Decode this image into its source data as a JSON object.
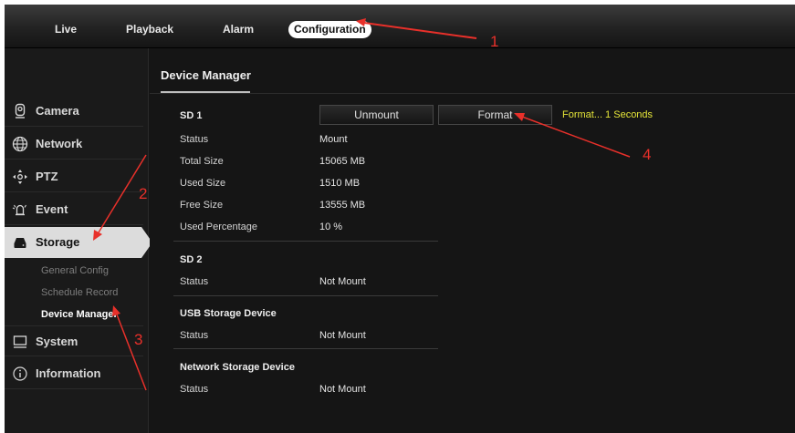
{
  "topnav": {
    "tabs": [
      {
        "label": "Live"
      },
      {
        "label": "Playback"
      },
      {
        "label": "Alarm"
      },
      {
        "label": "Configuration"
      }
    ]
  },
  "sidebar": {
    "items": [
      {
        "label": "Camera",
        "icon": "camera-icon"
      },
      {
        "label": "Network",
        "icon": "globe-icon"
      },
      {
        "label": "PTZ",
        "icon": "ptz-icon"
      },
      {
        "label": "Event",
        "icon": "event-icon"
      },
      {
        "label": "Storage",
        "icon": "storage-icon"
      },
      {
        "label": "System",
        "icon": "monitor-icon"
      },
      {
        "label": "Information",
        "icon": "info-icon"
      }
    ],
    "storage_subitems": [
      {
        "label": "General Config"
      },
      {
        "label": "Schedule Record"
      },
      {
        "label": "Device Manager"
      }
    ]
  },
  "main": {
    "title": "Device Manager",
    "sd1": {
      "title": "SD 1",
      "unmount_label": "Unmount",
      "format_label": "Format",
      "format_status": "Format... 1 Seconds",
      "rows": [
        {
          "label": "Status",
          "value": "Mount"
        },
        {
          "label": "Total Size",
          "value": "15065 MB"
        },
        {
          "label": "Used Size",
          "value": "1510 MB"
        },
        {
          "label": "Free Size",
          "value": "13555 MB"
        },
        {
          "label": "Used Percentage",
          "value": "10 %"
        }
      ]
    },
    "sd2": {
      "title": "SD 2",
      "rows": [
        {
          "label": "Status",
          "value": "Not Mount"
        }
      ]
    },
    "usb": {
      "title": "USB Storage Device",
      "rows": [
        {
          "label": "Status",
          "value": "Not Mount"
        }
      ]
    },
    "network": {
      "title": "Network Storage Device",
      "rows": [
        {
          "label": "Status",
          "value": "Not Mount"
        }
      ]
    }
  },
  "annotations": {
    "marker_1": "1",
    "marker_2": "2",
    "marker_3": "3",
    "marker_4": "4",
    "color": "#e8302a"
  },
  "colors": {
    "format_status": "#e6e639",
    "active_sidebar": "#dcdcdc"
  }
}
